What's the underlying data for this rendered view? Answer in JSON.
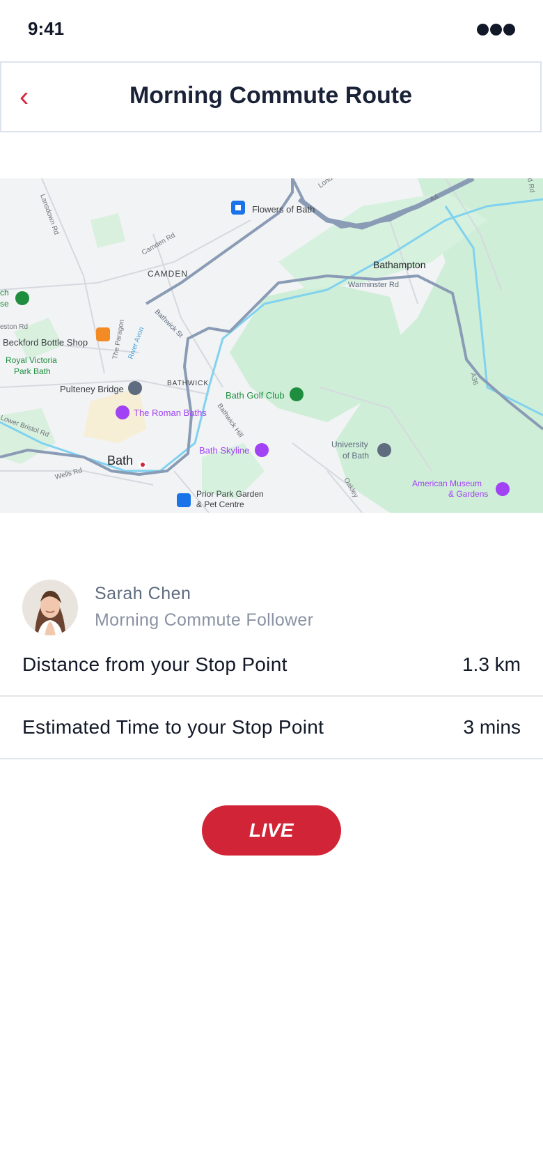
{
  "status_bar": {
    "time": "9:41"
  },
  "header": {
    "back_icon": "chevron-left-icon",
    "title": "Morning Commute Route"
  },
  "map": {
    "labels": {
      "flowers_of_bath": "Flowers of Bath",
      "bathampton": "Bathampton",
      "warminster_rd": "Warminster Rd",
      "camden": "CAMDEN",
      "camden_rd": "Camden Rd",
      "lansdown_rd": "Lansdown Rd",
      "beckford": "Beckford Bottle Shop",
      "royal_victoria_1": "Royal Victoria",
      "royal_victoria_2": "Park Bath",
      "pulteney": "Pulteney Bridge",
      "roman_baths": "The Roman Baths",
      "bathwick": "BATHWICK",
      "bathwick_st": "Bathwick St",
      "bathwick_hill": "Bathwick Hill",
      "bath_golf": "Bath Golf Club",
      "bath_skyline": "Bath Skyline",
      "university_1": "University",
      "university_2": "of Bath",
      "bath": "Bath",
      "prior_park_1": "Prior Park Garden",
      "prior_park_2": "& Pet Centre",
      "american_museum_1": "American Museum",
      "american_museum_2": "& Gardens",
      "wells_rd": "Wells Rd",
      "lower_bristol_rd": "Lower Bristol Rd",
      "oakley": "Oakley",
      "a36": "A36",
      "a4": "A4",
      "river_avon": "River Avon",
      "the_paragon": "The Paragon",
      "london": "London",
      "weston_rd": "eston Rd",
      "ch": "ch",
      "se": "se",
      "d_rd": "d Rd"
    }
  },
  "follower": {
    "name": "Sarah Chen",
    "role": "Morning Commute Follower",
    "avatar": "avatar-photo"
  },
  "stats": [
    {
      "label": "Distance from your Stop Point",
      "value": "1.3 km"
    },
    {
      "label": "Estimated Time to your Stop Point",
      "value": "3 mins"
    }
  ],
  "live_button": {
    "label": "LIVE"
  },
  "colors": {
    "accent": "#d12436",
    "title": "#1a2238",
    "park_green": "#cdebd6",
    "route": "#8a9bb5",
    "water": "#7fd0ee"
  }
}
